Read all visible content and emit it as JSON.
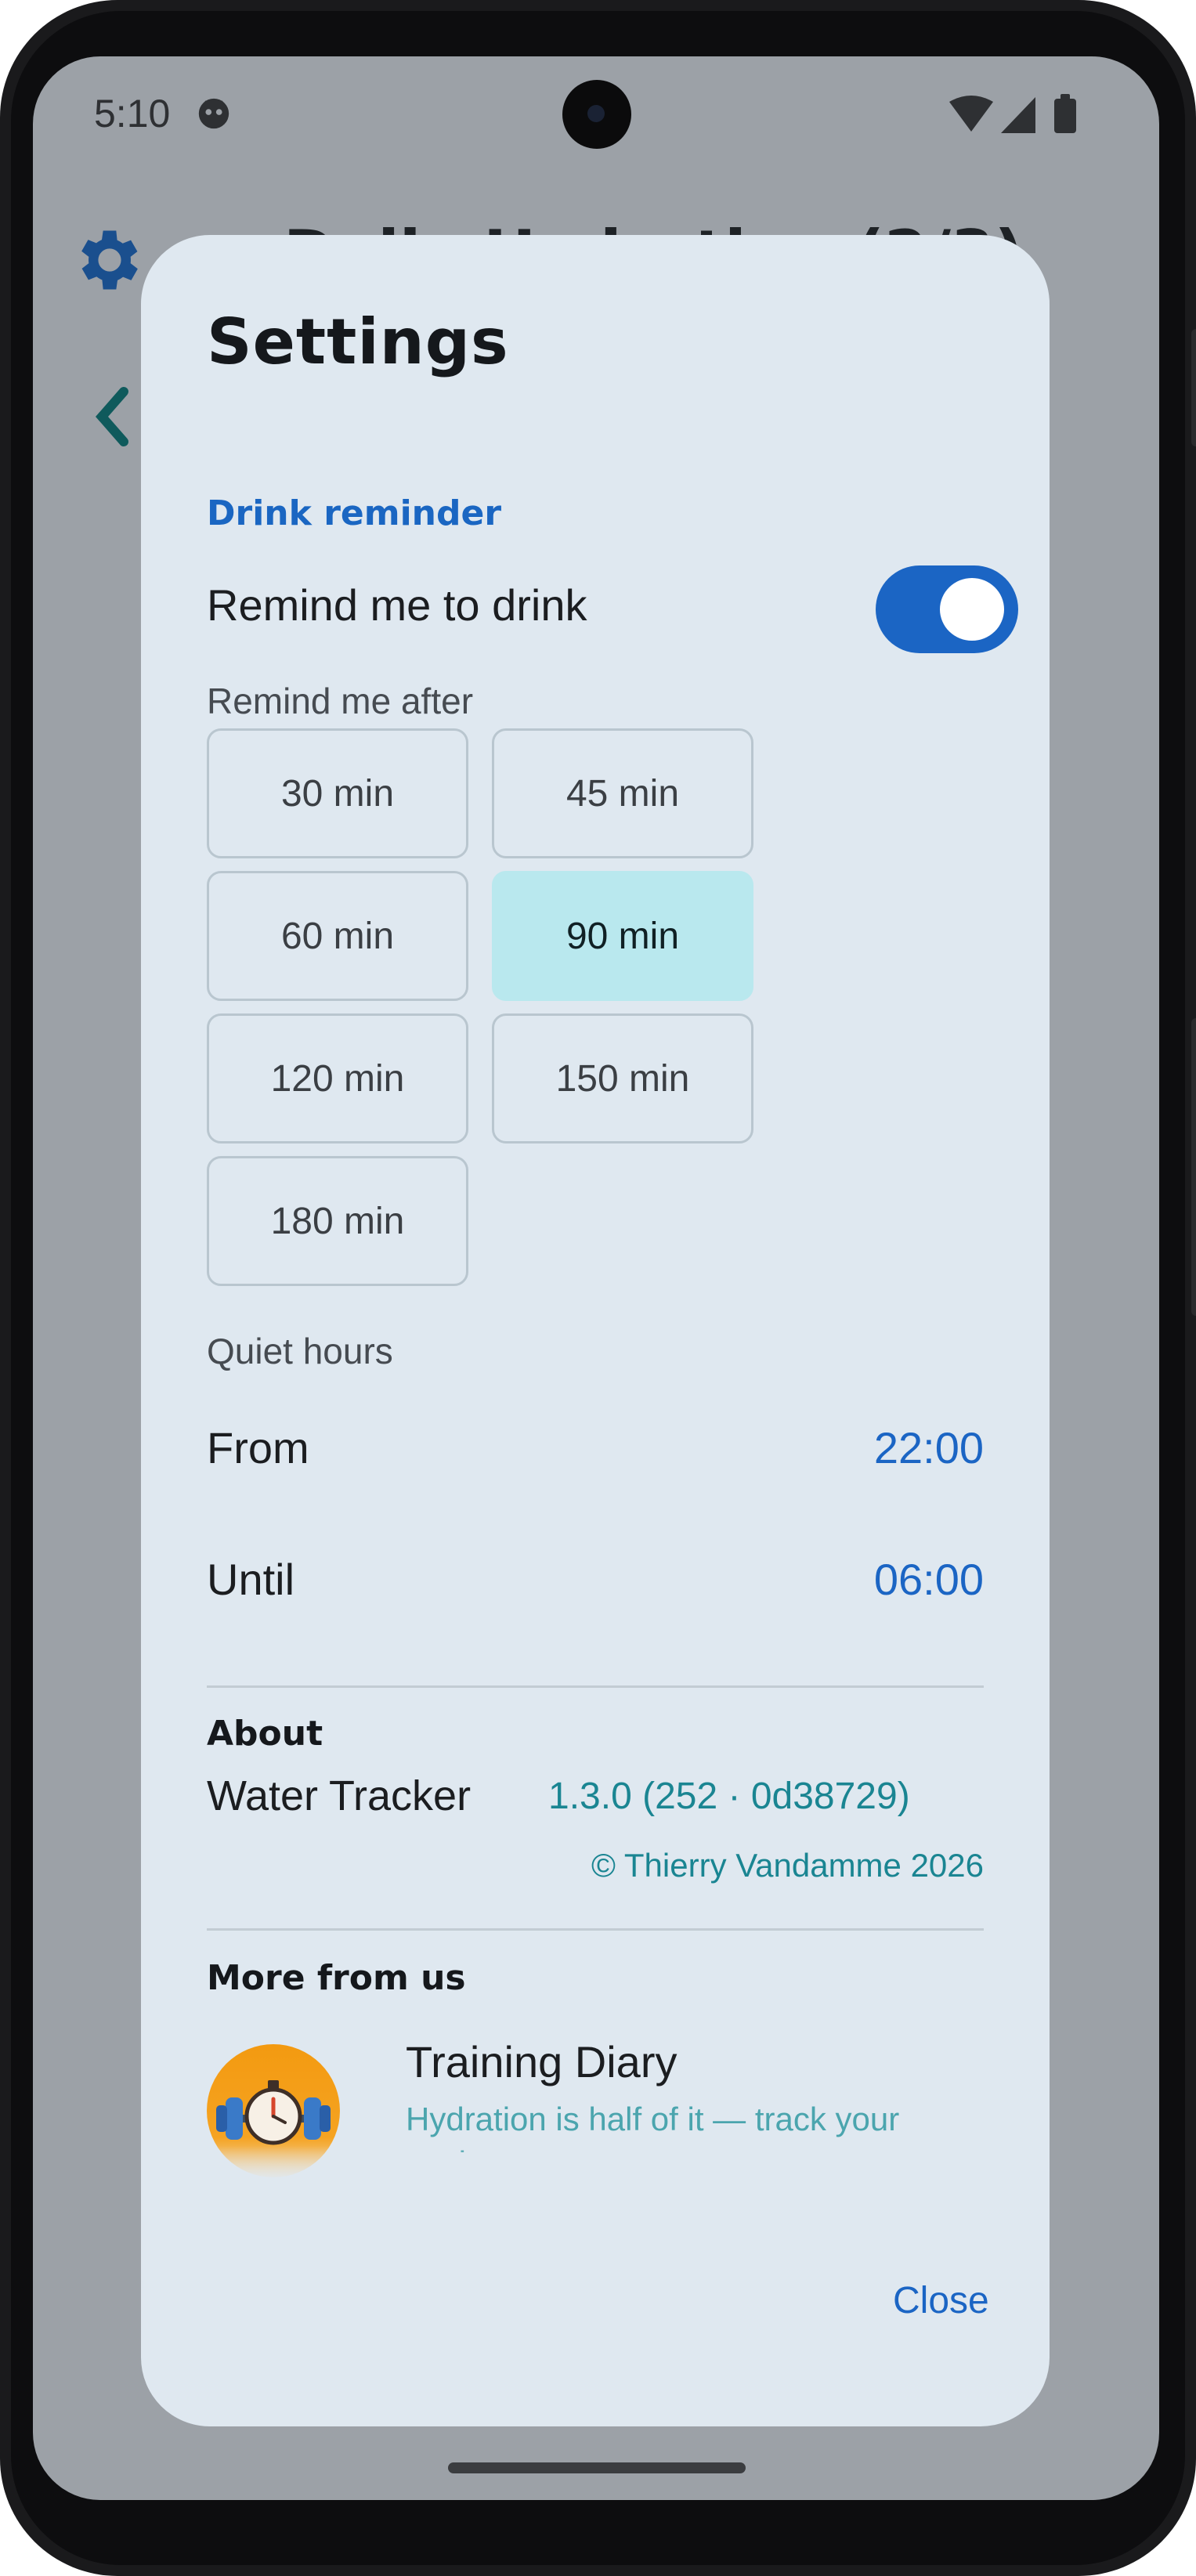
{
  "status_bar": {
    "time": "5:10"
  },
  "colors": {
    "accent": "#1b65c4",
    "teal": "#1a8592",
    "selected_chip": "#b9e8ee",
    "dialog_bg": "#dfe8f0"
  },
  "background": {
    "title": "Daily Hydration (2/3)"
  },
  "dialog": {
    "title": "Settings",
    "drink_section": "Drink reminder",
    "remind_label": "Remind me to drink",
    "remind_enabled": true,
    "after_label": "Remind me after",
    "intervals": [
      "30 min",
      "45 min",
      "60 min",
      "90 min",
      "120 min",
      "150 min",
      "180 min"
    ],
    "selected_interval": "90 min",
    "quiet_hours_label": "Quiet hours",
    "from_label": "From",
    "from_value": "22:00",
    "until_label": "Until",
    "until_value": "06:00",
    "about_head": "About",
    "app_name": "Water Tracker",
    "version": "1.3.0 (252 · 0d38729)",
    "copyright": "© Thierry Vandamme 2026",
    "more_head": "More from us",
    "promo_title": "Training Diary",
    "promo_sub": "Hydration is half of it — track your workouts too",
    "close_label": "Close"
  }
}
